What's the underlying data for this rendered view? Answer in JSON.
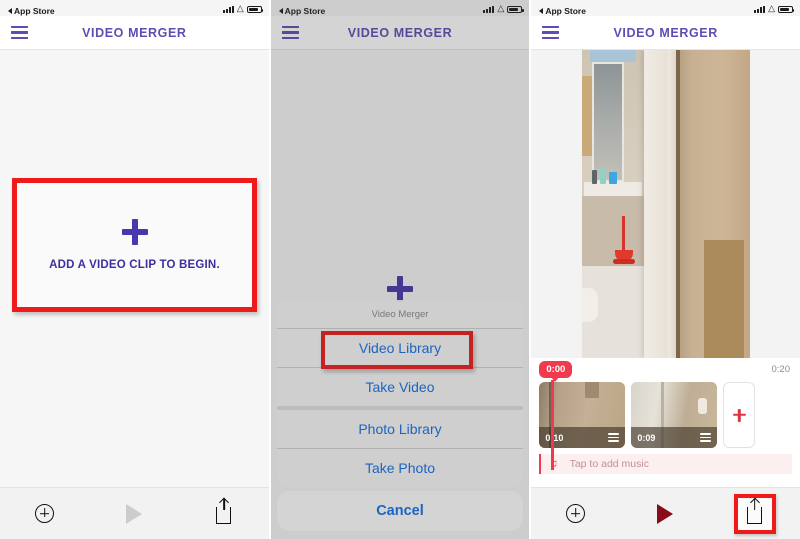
{
  "statusbar": {
    "back_label": "App Store",
    "icons": [
      "signal-icon",
      "wifi-icon",
      "battery-icon"
    ]
  },
  "app": {
    "title": "VIDEO MERGER",
    "menu_icon": "hamburger-menu-icon",
    "accent_purple": "#5b4fb5",
    "highlight_red": "#ee1b1b"
  },
  "panel1": {
    "add_clip_prompt": "ADD A VIDEO CLIP TO BEGIN.",
    "plus_icon": "plus-icon",
    "toolbar": {
      "add_label": "add-clip-icon",
      "play_label": "play-icon",
      "share_label": "share-icon"
    }
  },
  "panel2": {
    "plus_icon": "plus-icon",
    "sheet": {
      "title": "Video Merger",
      "items": [
        {
          "label": "Video Library",
          "highlighted": true
        },
        {
          "label": "Take Video",
          "highlighted": false
        },
        {
          "label": "Photo Library",
          "highlighted": false
        },
        {
          "label": "Take Photo",
          "highlighted": false
        }
      ],
      "cancel_label": "Cancel"
    }
  },
  "panel3": {
    "timeline": {
      "playhead_time": "0:00",
      "total_duration": "0:20",
      "clips": [
        {
          "duration": "0:10",
          "handle_icon": "drag-handle-icon"
        },
        {
          "duration": "0:09",
          "handle_icon": "drag-handle-icon"
        }
      ],
      "add_clip_icon": "plus-icon",
      "music_note_icon": "music-note-icon",
      "music_label": "Tap to add music"
    },
    "toolbar": {
      "add_label": "add-clip-icon",
      "play_label": "play-icon",
      "share_label": "share-icon"
    }
  }
}
